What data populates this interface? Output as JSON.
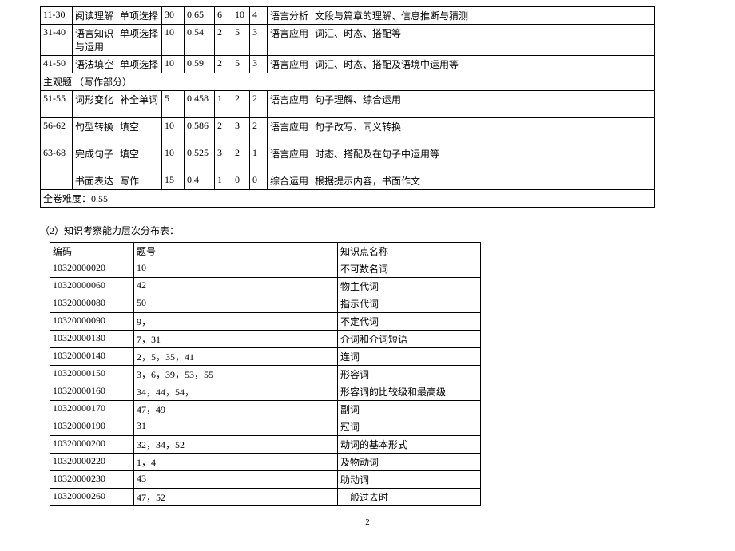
{
  "table1": {
    "rows": [
      {
        "qnum": "11-30",
        "topic": "阅读理解",
        "type": "单项选择",
        "score": "30",
        "diff": "0.65",
        "a": "6",
        "b": "10",
        "c": "4",
        "ability": "语言分析",
        "note": "文段与篇章的理解、信息推断与猜测"
      },
      {
        "qnum": "31-40",
        "topic": "语言知识与运用",
        "type": "单项选择",
        "score": "10",
        "diff": "0.54",
        "a": "2",
        "b": "5",
        "c": "3",
        "ability": "语言应用",
        "note": "词汇、时态、搭配等"
      },
      {
        "qnum": "41-50",
        "topic": "语法填空",
        "type": "单项选择",
        "score": "10",
        "diff": "0.59",
        "a": "2",
        "b": "5",
        "c": "3",
        "ability": "语言应用",
        "note": "词汇、时态、搭配及语境中运用等"
      }
    ],
    "subjective_header": "主观题 （写作部分）",
    "rows2": [
      {
        "qnum": "51-55",
        "topic": "词形变化",
        "type": "补全单词",
        "score": "5",
        "diff": "0.458",
        "a": "1",
        "b": "2",
        "c": "2",
        "ability": "语言应用",
        "note": "句子理解、综合运用"
      },
      {
        "qnum": "56-62",
        "topic": "句型转换",
        "type": "填空",
        "score": "10",
        "diff": "0.586",
        "a": "2",
        "b": "3",
        "c": "2",
        "ability": "语言应用",
        "note": "句子改写、同义转换"
      },
      {
        "qnum": "63-68",
        "topic": "完成句子",
        "type": "填空",
        "score": "10",
        "diff": "0.525",
        "a": "3",
        "b": "2",
        "c": "1",
        "ability": "语言应用",
        "note": "时态、搭配及在句子中运用等"
      },
      {
        "qnum": "",
        "topic": "书面表达",
        "type": "写作",
        "score": "15",
        "diff": "0.4",
        "a": "1",
        "b": "0",
        "c": "0",
        "ability": "综合运用",
        "note": "根据提示内容，书面作文"
      }
    ],
    "footer": "全卷难度：0.55"
  },
  "section2_title": "（2）知识考察能力层次分布表：",
  "table2": {
    "headers": {
      "code": "编码",
      "q": "题号",
      "kp": "知识点名称"
    },
    "rows": [
      {
        "code": "10320000020",
        "q": "10",
        "kp": "不可数名词"
      },
      {
        "code": "10320000060",
        "q": "42",
        "kp": "物主代词"
      },
      {
        "code": "10320000080",
        "q": "50",
        "kp": "指示代词"
      },
      {
        "code": "10320000090",
        "q": "9，",
        "kp": "不定代词"
      },
      {
        "code": "10320000130",
        "q": "7，31",
        "kp": "介词和介词短语"
      },
      {
        "code": "10320000140",
        "q": "2，5，35，41",
        "kp": "连词"
      },
      {
        "code": "10320000150",
        "q": "3，6，39，53，55",
        "kp": "形容词"
      },
      {
        "code": "10320000160",
        "q": "34，44，54，",
        "kp": "形容词的比较级和最高级"
      },
      {
        "code": "10320000170",
        "q": "47，49",
        "kp": "副词"
      },
      {
        "code": "10320000190",
        "q": "31",
        "kp": "冠词"
      },
      {
        "code": "10320000200",
        "q": "32，34，52",
        "kp": "动词的基本形式"
      },
      {
        "code": "10320000220",
        "q": "1，4",
        "kp": "及物动词"
      },
      {
        "code": "10320000230",
        "q": "43",
        "kp": "助动词"
      },
      {
        "code": "10320000260",
        "q": "47，52",
        "kp": "一般过去时"
      }
    ]
  },
  "page_number": "2"
}
